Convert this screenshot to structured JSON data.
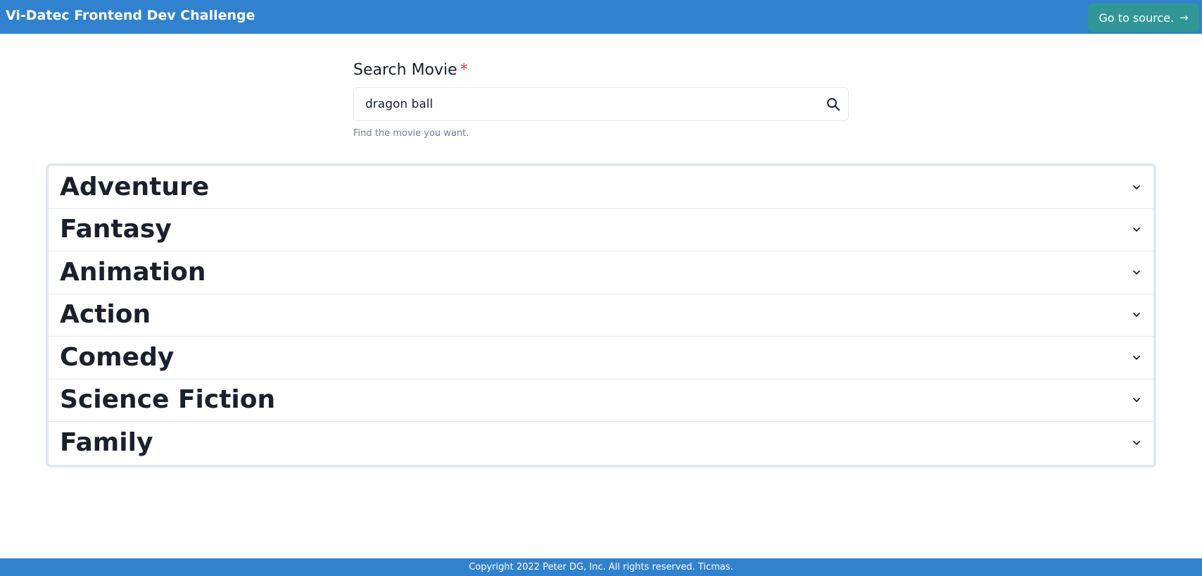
{
  "header": {
    "title": "Vi-Datec Frontend Dev Challenge",
    "source_button_label": "Go to source.",
    "source_button_icon": "arrow-right-icon"
  },
  "search": {
    "label": "Search Movie",
    "required_mark": "*",
    "value": "dragon ball",
    "helper": "Find the movie you want.",
    "icon": "search-icon"
  },
  "genres": [
    {
      "label": "Adventure"
    },
    {
      "label": "Fantasy"
    },
    {
      "label": "Animation"
    },
    {
      "label": "Action"
    },
    {
      "label": "Comedy"
    },
    {
      "label": "Science Fiction"
    },
    {
      "label": "Family"
    }
  ],
  "footer": {
    "copyright": "Copyright 2022 Peter DG, Inc. All rights reserved. Ticmas."
  },
  "colors": {
    "header_bg": "#3182ce",
    "button_bg": "#319795",
    "required": "#e53e3e",
    "text": "#1a202c"
  }
}
